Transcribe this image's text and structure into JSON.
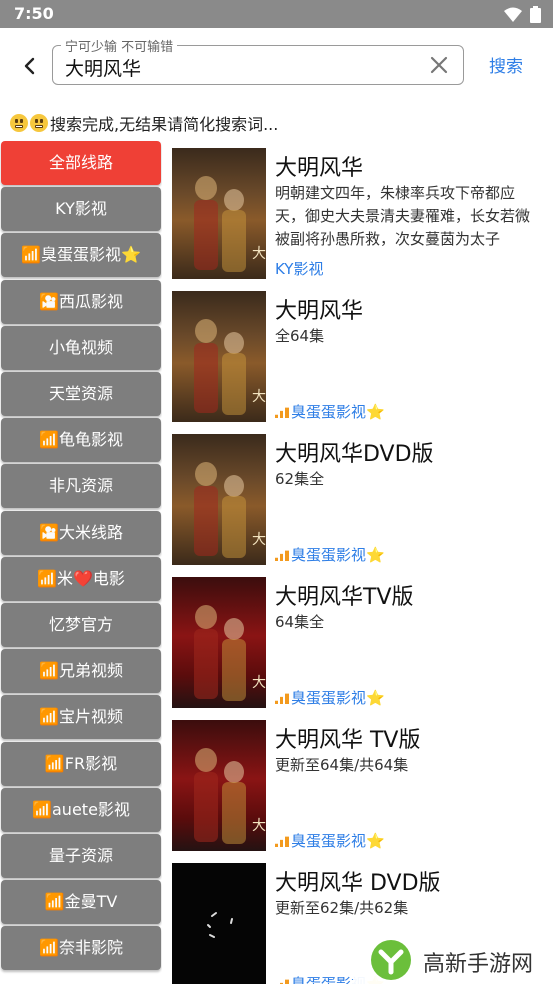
{
  "status_bar": {
    "time": "7:50"
  },
  "search": {
    "legend": "宁可少输 不可输错",
    "value": "大明风华",
    "submit_label": "搜索"
  },
  "status_message": "搜索完成,无结果请简化搜索词...",
  "sources": [
    {
      "label": "全部线路",
      "active": true
    },
    {
      "label": "KY影视"
    },
    {
      "label": "📶臭蛋蛋影视⭐"
    },
    {
      "label": "🎦西瓜影视"
    },
    {
      "label": "小龟视频"
    },
    {
      "label": "天堂资源"
    },
    {
      "label": "📶龟龟影视"
    },
    {
      "label": "非凡资源"
    },
    {
      "label": "🎦大米线路"
    },
    {
      "label": "📶米❤️电影"
    },
    {
      "label": "忆梦官方"
    },
    {
      "label": "📶兄弟视频"
    },
    {
      "label": "📶宝片视频"
    },
    {
      "label": "📶FR影视"
    },
    {
      "label": "📶auete影视"
    },
    {
      "label": "量子资源"
    },
    {
      "label": "📶金曼TV"
    },
    {
      "label": "📶奈非影院"
    }
  ],
  "results": [
    {
      "title": "大明风华",
      "desc": "明朝建文四年，朱棣率兵攻下帝都应天，御史大夫景清夫妻罹难，长女若微被副将孙愚所救，次女蔓茵为太子",
      "source": "KY影视",
      "poster": "poster-a"
    },
    {
      "title": "大明风华",
      "desc": "全64集",
      "source": "臭蛋蛋影视⭐",
      "poster": "poster-a"
    },
    {
      "title": "大明风华DVD版",
      "desc": "62集全",
      "source": "臭蛋蛋影视⭐",
      "poster": "poster-a"
    },
    {
      "title": "大明风华TV版",
      "desc": "64集全",
      "source": "臭蛋蛋影视⭐",
      "poster": "poster-b"
    },
    {
      "title": "大明风华 TV版",
      "desc": "更新至64集/共64集",
      "source": "臭蛋蛋影视⭐",
      "poster": "poster-b"
    },
    {
      "title": "大明风华 DVD版",
      "desc": "更新至62集/共62集",
      "source": "臭蛋蛋影视⭐",
      "poster": "poster-c"
    }
  ],
  "watermark": {
    "text": "高新手游网"
  },
  "colors": {
    "accent": "#2e7ee6",
    "active_source": "#ef4036",
    "source_bg": "#7e7e7e",
    "status_bar": "#8a8a8a"
  },
  "icons": {
    "back": "chevron-left-icon",
    "clear": "close-icon",
    "wifi": "wifi-icon",
    "battery": "battery-icon"
  }
}
